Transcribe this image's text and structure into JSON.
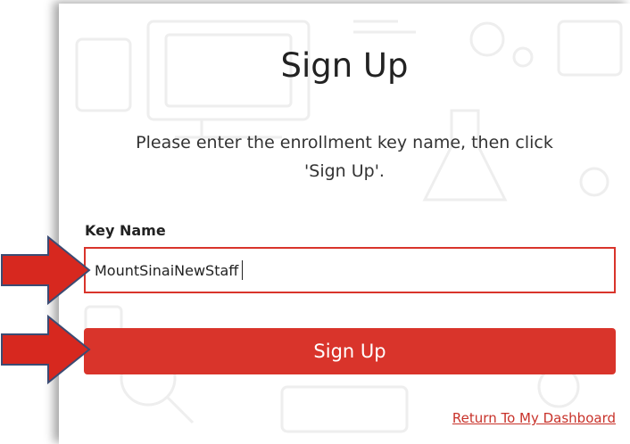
{
  "colors": {
    "accent": "#d9342b",
    "link": "#c8322a",
    "arrow_fill": "#d7281f",
    "arrow_stroke": "#3b4b73"
  },
  "form": {
    "title": "Sign Up",
    "instructions_line1": "Please enter the enrollment key name, then click",
    "instructions_line2": "'Sign Up'.",
    "key_label": "Key Name",
    "key_value": "MountSinaiNewStaff",
    "submit_label": "Sign Up",
    "dashboard_link": "Return To My Dashboard"
  },
  "annotations": {
    "arrow_icon": "right-arrow-icon"
  }
}
